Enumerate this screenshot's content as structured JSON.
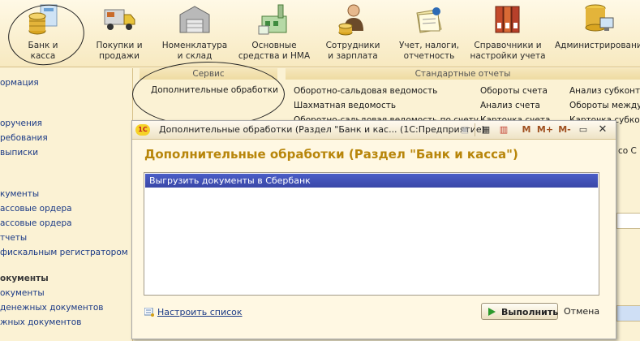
{
  "sections": [
    {
      "line1": "Банк и",
      "line2": "касса",
      "icon": "coins-money-icon"
    },
    {
      "line1": "Покупки и",
      "line2": "продажи",
      "icon": "truck-icon"
    },
    {
      "line1": "Номенклатура",
      "line2": "и склад",
      "icon": "warehouse-icon"
    },
    {
      "line1": "Основные",
      "line2": "средства и НМА",
      "icon": "factory-icon"
    },
    {
      "line1": "Сотрудники",
      "line2": "и зарплата",
      "icon": "employee-icon"
    },
    {
      "line1": "Учет, налоги,",
      "line2": "отчетность",
      "icon": "documents-icon"
    },
    {
      "line1": "Справочники и",
      "line2": "настройки учета",
      "icon": "binders-icon"
    },
    {
      "line1": "Администрирование",
      "line2": "",
      "icon": "database-icon"
    }
  ],
  "left_panel": {
    "items": [
      "ормация",
      "оручения",
      "ребования",
      "выписки",
      "кументы",
      "ассовые ордера",
      "ассовые ордера",
      "тчеты",
      "фискальным регистратором"
    ],
    "group_head": "окументы",
    "items2": [
      "окументы",
      " денежных документов",
      "жных документов"
    ]
  },
  "service": {
    "header": "Сервис",
    "item": "Дополнительные обработки"
  },
  "standard_reports": {
    "header": "Стандартные отчеты",
    "col1": [
      "Оборотно-сальдовая ведомость",
      "Шахматная ведомость",
      "Оборотно-сальдовая ведомость по счету"
    ],
    "col2": [
      "Обороты счета",
      "Анализ счета",
      "Карточка счета"
    ],
    "col3": [
      "Анализ субконто",
      "Обороты между с",
      "Карточка субконт"
    ],
    "side_fragment": "со С"
  },
  "modal": {
    "title": "Дополнительные обработки (Раздел \"Банк и кас...  (1С:Предприятие)",
    "logo": "1С",
    "m": "M",
    "mplus": "M+",
    "mminus": "M-",
    "heading": "Дополнительные обработки (Раздел \"Банк и касса\")",
    "list": [
      "Выгрузить документы в Сбербанк"
    ],
    "configure": "Настроить список",
    "run": "Выполнить",
    "cancel": "Отмена"
  },
  "colors": {
    "accent_heading": "#b8860b",
    "selection": "#3f4fb4",
    "link": "#1b3a86"
  }
}
